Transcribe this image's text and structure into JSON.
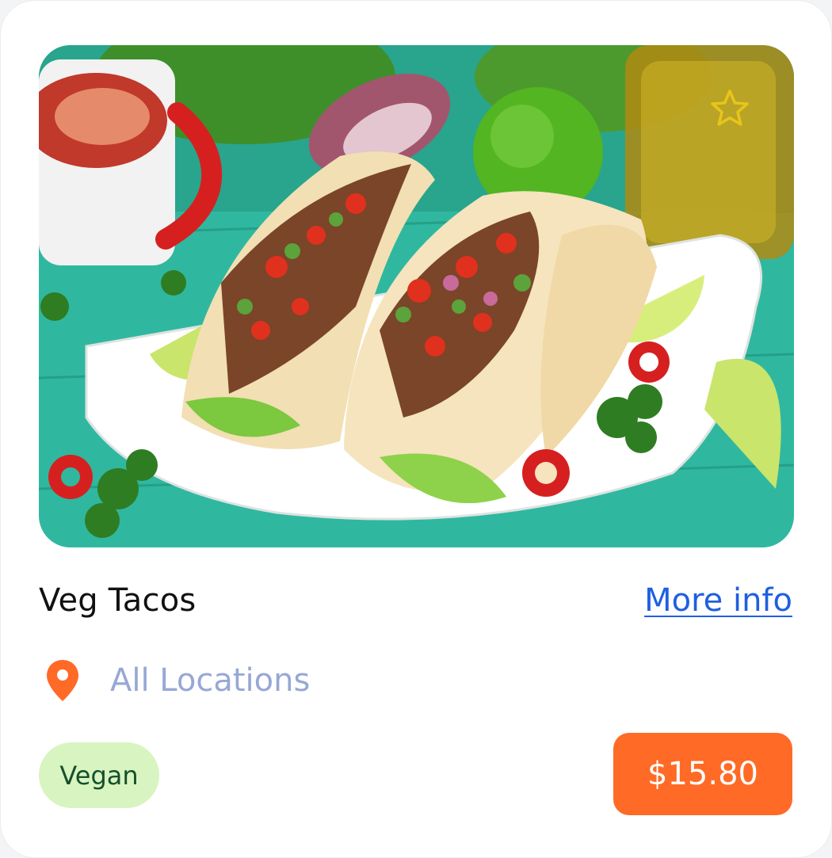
{
  "product": {
    "image_alt": "Tacos with beef, vegetables and lime on a white plate",
    "title": "Veg Tacos",
    "more_info_label": "More info",
    "location_label": "All Locations",
    "tag_label": "Vegan",
    "price_label": "$15.80"
  },
  "icons": {
    "favorite": "star-outline-icon",
    "location": "map-pin-icon"
  },
  "colors": {
    "accent_orange": "#ff6a26",
    "link_blue": "#1f5fe0",
    "muted_text": "#97a8d6",
    "tag_bg": "#d8f4c0",
    "tag_text": "#15502c",
    "star": "#e8c51a"
  }
}
